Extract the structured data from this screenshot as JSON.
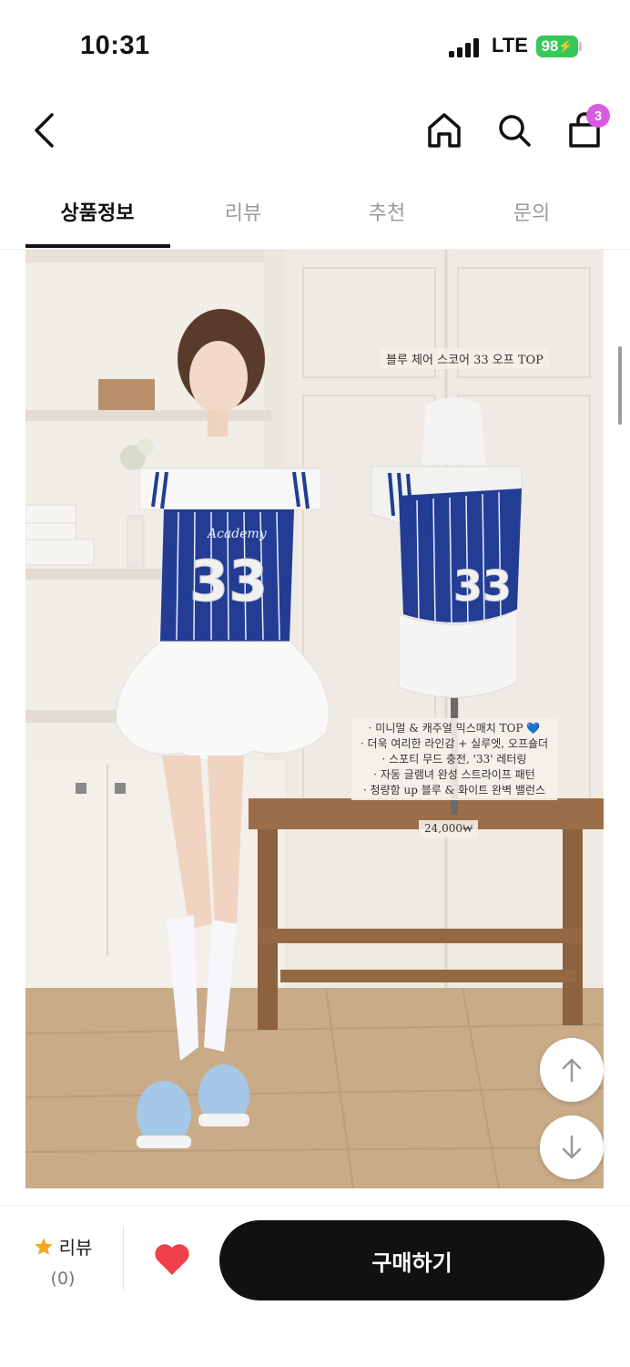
{
  "status_bar": {
    "time": "10:31",
    "network": "LTE",
    "battery": "98"
  },
  "header": {
    "icons": [
      "back-arrow-icon",
      "home-icon",
      "search-icon",
      "shopping-bag-icon"
    ],
    "cart_badge": "3",
    "badge_color": "#d85be0"
  },
  "tabs": [
    {
      "label": "상품정보",
      "active": true
    },
    {
      "label": "리뷰",
      "active": false
    },
    {
      "label": "추천",
      "active": false
    },
    {
      "label": "문의",
      "active": false
    }
  ],
  "product_image": {
    "caption_title": "블루 체어 스코어 33 오프 TOP",
    "features": [
      "· 미니멀 & 캐주얼 믹스매치 TOP 💙",
      "· 더욱 여리한 라인감 + 실루엣, 오프숄더",
      "· 스포티 무드 충전, '33' 레터링",
      "· 자동 글램녀 완성 스트라이프 패턴",
      "· 청량함 up 블루 & 화이트 완벽 밸런스"
    ],
    "price": "24,000₩",
    "jersey_number": "33",
    "jersey_script": "Academy"
  },
  "floating_buttons": [
    "arrow-up-icon",
    "arrow-down-icon"
  ],
  "bottom_bar": {
    "review_label": "리뷰",
    "review_count": "(0)",
    "buy_label": "구매하기",
    "heart_color": "#f0404a",
    "star_color": "#f5a623"
  }
}
